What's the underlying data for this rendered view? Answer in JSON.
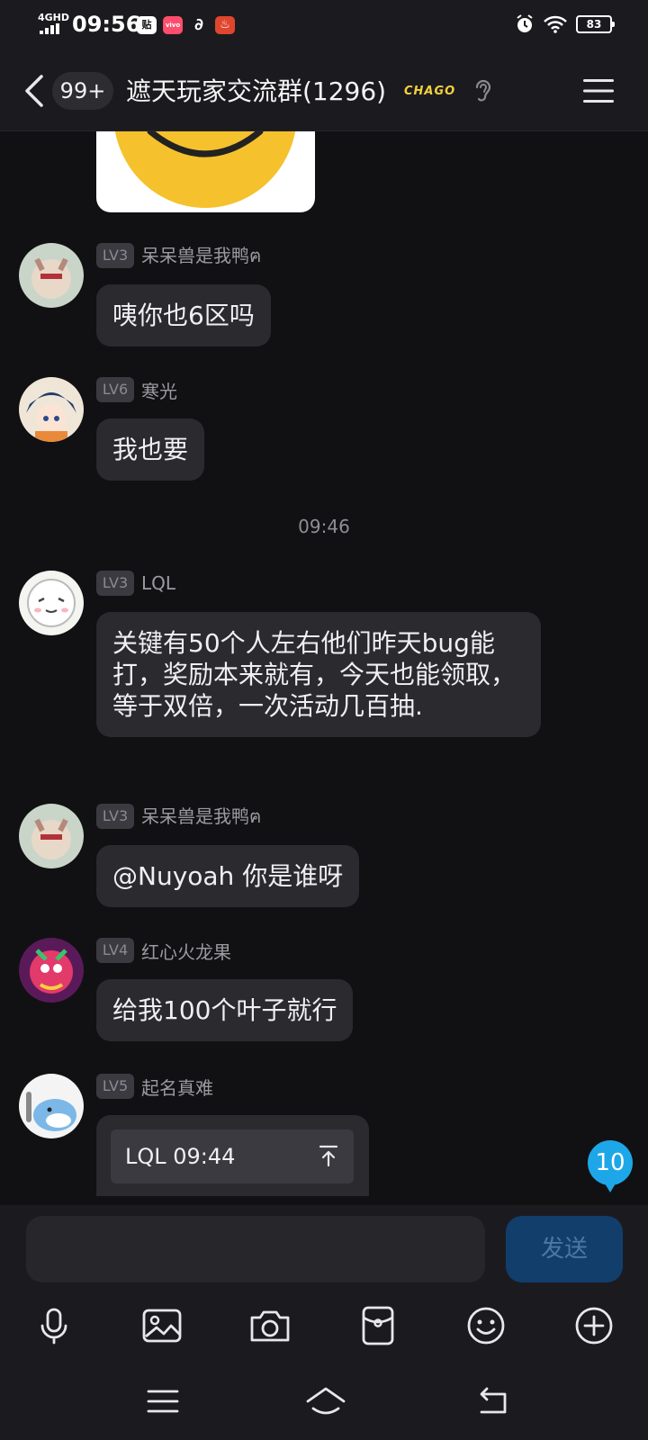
{
  "status_bar": {
    "network": "4GHD",
    "time": "09:56",
    "app_icons": [
      "贴",
      "vivo",
      "∂",
      "♨"
    ],
    "battery": "83"
  },
  "header": {
    "unread_count": "99+",
    "title": "遮天玩家交流群(1296)",
    "badge": "CHAGO"
  },
  "messages": [
    {
      "level": "LV3",
      "nick": "呆呆兽是我鸭ฅ",
      "text": "咦你也6区吗"
    },
    {
      "level": "LV6",
      "nick": "寒光",
      "text": "我也要"
    },
    {
      "level": "LV3",
      "nick": "LQL",
      "text": "关键有50个人左右他们昨天bug能打，奖励本来就有，今天也能领取，等于双倍，一次活动几百抽."
    },
    {
      "level": "LV3",
      "nick": "呆呆兽是我鸭ฅ",
      "text": "@Nuyoah 你是谁呀"
    },
    {
      "level": "LV4",
      "nick": "红心火龙果",
      "text": "给我100个叶子就行"
    },
    {
      "level": "LV5",
      "nick": "起名真难",
      "quote": "LQL 09:44"
    }
  ],
  "time_separator": "09:46",
  "unread_badge": "10",
  "input": {
    "placeholder": "",
    "send_label": "发送"
  },
  "colors": {
    "accent": "#1ea7e8",
    "send_bg": "#123e6b",
    "bubble": "#2a2a2f",
    "background": "#111113"
  }
}
